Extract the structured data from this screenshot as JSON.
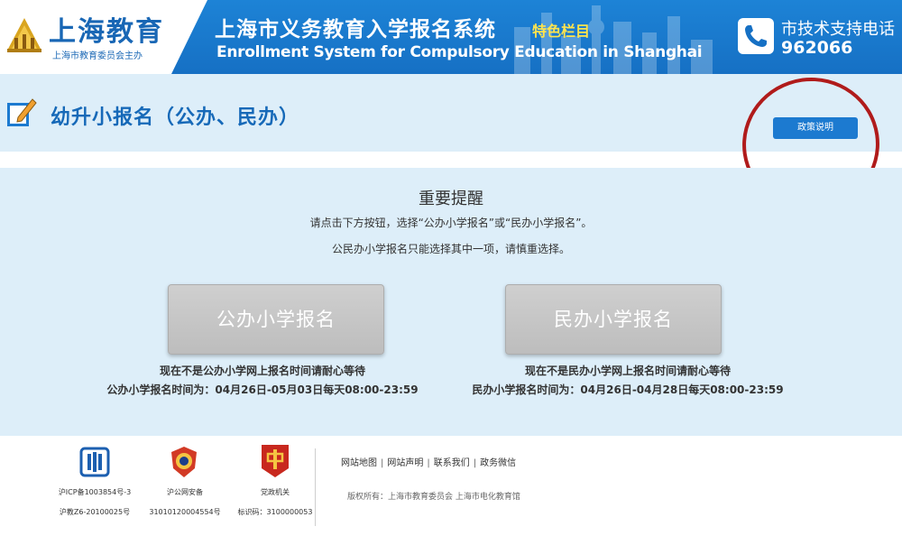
{
  "header": {
    "logo_title": "上海教育",
    "logo_subtitle": "上海市教育委员会主办",
    "site_title": "上海市义务教育入学报名系统",
    "site_tag": "特色栏目",
    "site_title_en": "Enrollment System for Compulsory Education in Shanghai",
    "support_label": "市技术支持电话",
    "support_phone": "962066",
    "colors": {
      "brand_blue": "#1670c4",
      "tag_yellow": "#ffe44d"
    }
  },
  "titlebar": {
    "title": "幼升小报名（公办、民办）",
    "policy_button": "政策说明"
  },
  "notice": {
    "title": "重要提醒",
    "line1": "请点击下方按钮，选择“公办小学报名”或“民办小学报名”。",
    "line2": "公民办小学报名只能选择其中一项，请慎重选择。"
  },
  "enroll": {
    "public": {
      "button": "公办小学报名",
      "status": "现在不是公办小学网上报名时间请耐心等待",
      "time": "公办小学报名时间为：04月26日-05月03日每天08:00-23:59"
    },
    "private": {
      "button": "民办小学报名",
      "status": "现在不是民办小学网上报名时间请耐心等待",
      "time": "民办小学报名时间为：04月26日-04月28日每天08:00-23:59"
    }
  },
  "footer": {
    "badges": [
      {
        "icon": "icp-icon",
        "line1": "沪ICP备1003854号-3",
        "line2": "沪教Z6-20100025号"
      },
      {
        "icon": "police-emblem-icon",
        "line1": "沪公网安备",
        "line2": "31010120004554号"
      },
      {
        "icon": "party-org-icon",
        "line1": "党政机关",
        "line2": "标识码：3100000053"
      }
    ],
    "links": [
      "网站地图",
      "网站声明",
      "联系我们",
      "政务微信"
    ],
    "copyright": "版权所有：上海市教育委员会 上海市电化教育馆"
  }
}
